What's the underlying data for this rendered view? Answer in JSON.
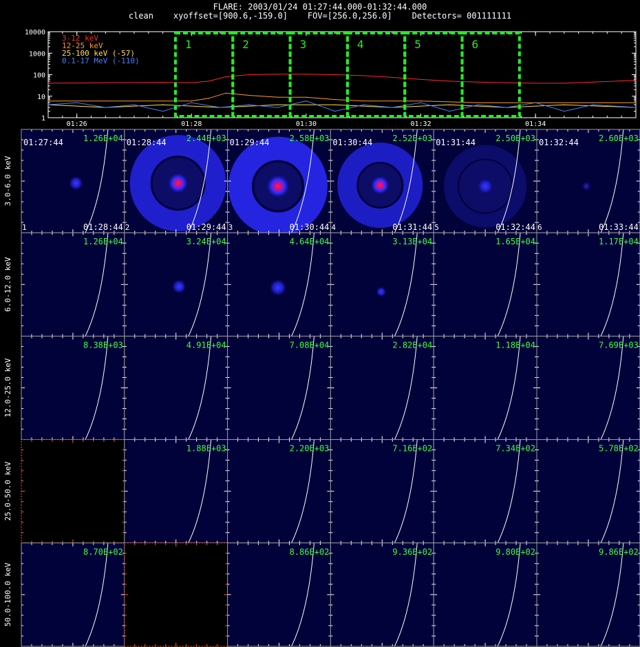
{
  "header": {
    "line1": "FLARE: 2003/01/24 01:27:44.000-01:32:44.000",
    "line2": "clean    xyoffset=[900.6,-159.0]    FOV=[256.0,256.0]    Detectors= 001111111"
  },
  "chart_data": [
    {
      "type": "line",
      "y_scale": "log",
      "ylim": [
        1,
        10000
      ],
      "y_ticks": [
        "10000",
        "1000",
        "100",
        "10",
        "1"
      ],
      "x_ticks": [
        "01:26",
        "01:28",
        "01:30",
        "01:32",
        "01:34"
      ],
      "x_tick_minutes": [
        86,
        88,
        90,
        92,
        94
      ],
      "xlim_minutes": [
        85.5,
        95.75
      ],
      "legend_position": "top-left",
      "series": [
        {
          "name": "3-12 keV",
          "color": "#ff2a2a",
          "x": [
            85.5,
            86.5,
            87.5,
            88.0,
            88.3,
            88.6,
            89.0,
            89.5,
            90.0,
            90.5,
            91.0,
            91.5,
            92.0,
            92.5,
            93.0,
            93.5,
            94.0,
            94.5,
            95.0,
            95.75
          ],
          "y": [
            40,
            42,
            44,
            42,
            50,
            80,
            100,
            105,
            105,
            100,
            90,
            75,
            60,
            50,
            45,
            42,
            40,
            40,
            45,
            55
          ]
        },
        {
          "name": "12-25 keV",
          "color": "#ff9a2a",
          "x": [
            85.5,
            86.5,
            87.5,
            88.0,
            88.3,
            88.6,
            89.0,
            89.5,
            90.0,
            90.5,
            91.0,
            91.5,
            92.0,
            93.0,
            94.0,
            95.0,
            95.75
          ],
          "y": [
            6,
            6,
            6,
            6,
            8,
            14,
            11,
            9,
            9,
            7,
            6,
            6,
            6,
            5,
            5,
            5,
            5
          ]
        },
        {
          "name": "25-100 keV (-57)",
          "color": "#ffe040",
          "x": [
            85.5,
            86.5,
            87.5,
            88.5,
            89.5,
            90.5,
            91.5,
            92.5,
            93.5,
            94.5,
            95.75
          ],
          "y": [
            4,
            3,
            4,
            3,
            4,
            4,
            3,
            4,
            3,
            4,
            3
          ]
        },
        {
          "name": "0.1-17 MeV (-110)",
          "color": "#4a7dff",
          "x": [
            85.5,
            86.0,
            86.5,
            87.0,
            87.5,
            88.0,
            88.5,
            89.0,
            89.5,
            90.0,
            90.5,
            91.0,
            91.5,
            92.0,
            92.5,
            93.0,
            93.5,
            94.0,
            94.5,
            95.0,
            95.75
          ],
          "y": [
            4,
            5,
            3,
            4,
            2,
            5,
            3,
            4,
            3,
            6,
            2,
            4,
            3,
            5,
            2,
            4,
            3,
            5,
            2,
            4,
            3
          ]
        }
      ],
      "intervals": [
        {
          "label": "1",
          "start": 87.72,
          "end": 88.72
        },
        {
          "label": "2",
          "start": 88.72,
          "end": 89.72
        },
        {
          "label": "3",
          "start": 89.72,
          "end": 90.72
        },
        {
          "label": "4",
          "start": 90.72,
          "end": 91.72
        },
        {
          "label": "5",
          "start": 91.72,
          "end": 92.72
        },
        {
          "label": "6",
          "start": 92.72,
          "end": 93.72
        }
      ]
    },
    {
      "type": "heatmap",
      "row_labels": [
        "3.0-6.0 keV",
        "6.0-12.0 keV",
        "12.0-25.0 keV",
        "25.0-50.0 keV",
        "50.0-100.0 keV"
      ],
      "col_start_times": [
        "01:27:44",
        "01:28:44",
        "01:29:44",
        "01:30:44",
        "01:31:44",
        "01:32:44"
      ],
      "col_end_times": [
        "01:28:44",
        "01:29:44",
        "01:30:44",
        "01:31:44",
        "01:32:44",
        "01:33:44"
      ],
      "col_numbers": [
        "1",
        "2",
        "3",
        "4",
        "5",
        "6"
      ],
      "max_values": [
        [
          "1.26E+04",
          "2.44E+03",
          "2.58E+03",
          "2.52E+03",
          "2.50E+03",
          "2.60E+03"
        ],
        [
          "1.26E+04",
          "3.24E+04",
          "4.64E+04",
          "3.13E+04",
          "1.65E+04",
          "1.17E+04"
        ],
        [
          "8.38E+03",
          "4.91E+04",
          "7.08E+04",
          "2.82E+04",
          "1.18E+04",
          "7.69E+03"
        ],
        [
          "",
          "1.88E+03",
          "2.20E+03",
          "7.16E+02",
          "7.34E+02",
          "5.78E+02"
        ],
        [
          "8.70E+02",
          "",
          "8.86E+02",
          "9.36E+02",
          "9.80E+02",
          "9.86E+02"
        ]
      ],
      "empty_cells": [
        [
          3,
          0
        ],
        [
          4,
          1
        ]
      ],
      "axis_color": "#ff6a2a",
      "max_label_color": "#3cff3c",
      "background_color": "#02023a",
      "source_colors": {
        "core": "#ff2030",
        "halo": "#2a2aff"
      }
    }
  ]
}
